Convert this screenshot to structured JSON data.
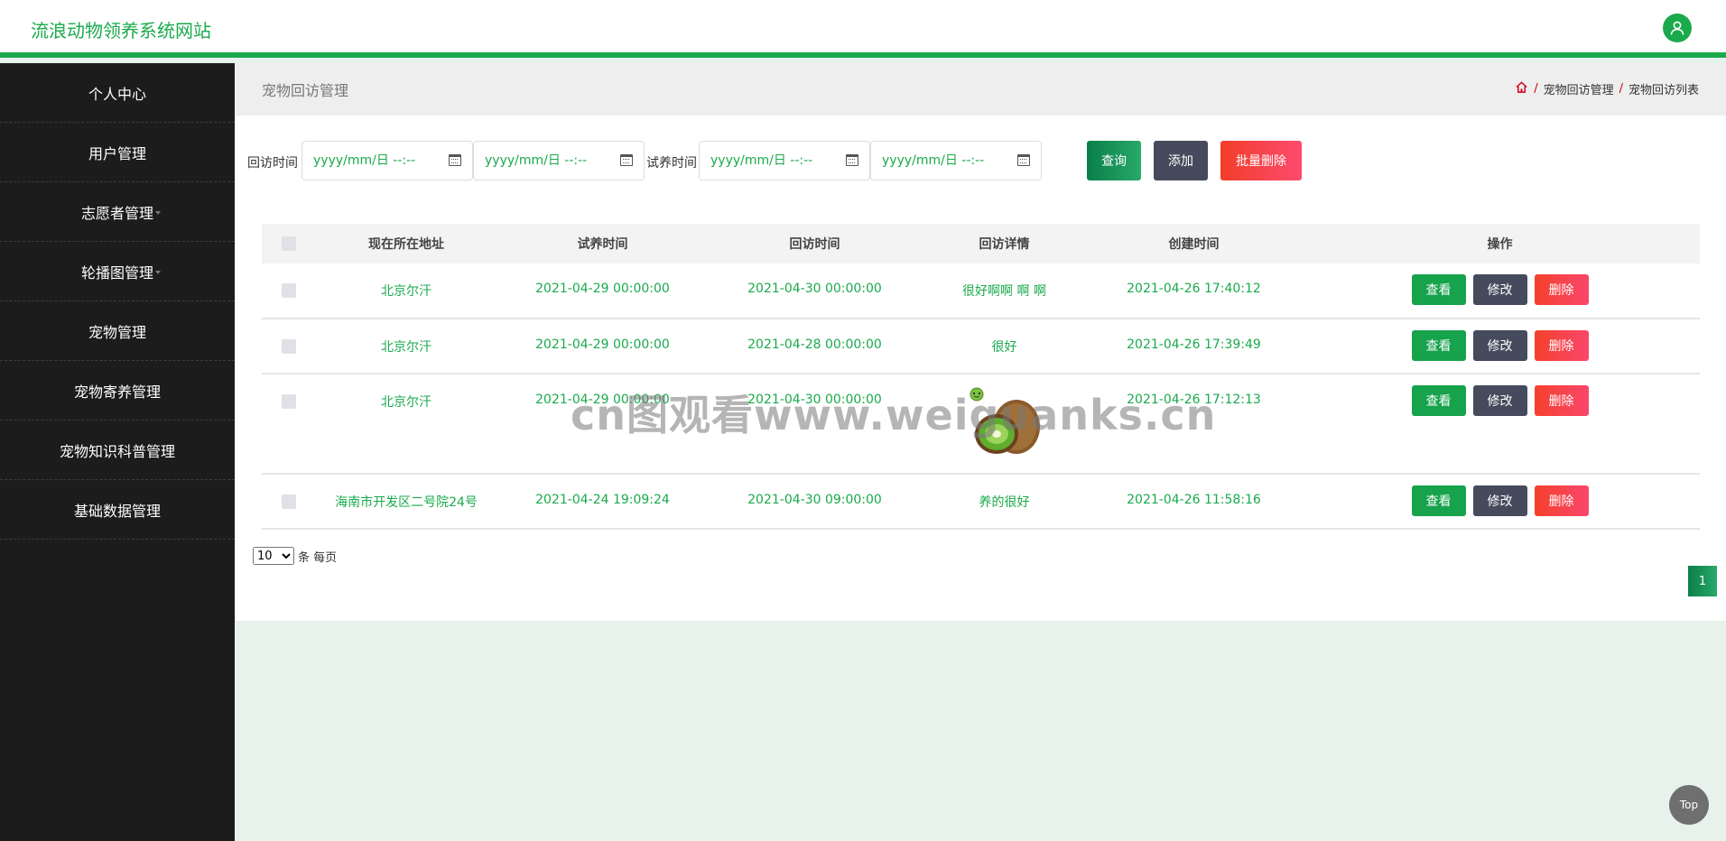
{
  "header": {
    "brand": "流浪动物领养系统网站",
    "user_icon": "user-icon"
  },
  "sidebar": {
    "items": [
      {
        "label": "个人中心",
        "caret": false
      },
      {
        "label": "用户管理",
        "caret": false
      },
      {
        "label": "志愿者管理",
        "caret": true
      },
      {
        "label": "轮播图管理",
        "caret": true
      },
      {
        "label": "宠物管理",
        "caret": false
      },
      {
        "label": "宠物寄养管理",
        "caret": false
      },
      {
        "label": "宠物知识科普管理",
        "caret": false
      },
      {
        "label": "基础数据管理",
        "caret": false
      }
    ]
  },
  "titlebar": {
    "title": "宠物回访管理",
    "breadcrumb": [
      "宠物回访管理",
      "宠物回访列表"
    ]
  },
  "search": {
    "visit_label": "回访时间",
    "trial_label": "试养时间",
    "placeholder": "yyyy/mm/日  --:--",
    "query_label": "查询",
    "add_label": "添加",
    "bulk_delete_label": "批量删除"
  },
  "table": {
    "headers": [
      "现在所在地址",
      "试养时间",
      "回访时间",
      "回访详情",
      "创建时间",
      "操作"
    ],
    "rows": [
      {
        "address": "北京尔汗",
        "trial_time": "2021-04-29 00:00:00",
        "visit_time": "2021-04-30 00:00:00",
        "detail": "很好啊啊 啊 啊",
        "created": "2021-04-26 17:40:12"
      },
      {
        "address": "北京尔汗",
        "trial_time": "2021-04-29 00:00:00",
        "visit_time": "2021-04-28 00:00:00",
        "detail": "很好",
        "created": "2021-04-26 17:39:49"
      },
      {
        "address": "北京尔汗",
        "trial_time": "2021-04-29 00:00:00",
        "visit_time": "2021-04-30 00:00:00",
        "detail": "",
        "created": "2021-04-26 17:12:13"
      },
      {
        "address": "海南市开发区二号院24号",
        "trial_time": "2021-04-24 19:09:24",
        "visit_time": "2021-04-30 09:00:00",
        "detail": "养的很好",
        "created": "2021-04-26 11:58:16"
      }
    ],
    "ops": {
      "view": "查看",
      "edit": "修改",
      "delete": "删除"
    }
  },
  "pager": {
    "page_size": "10",
    "suffix": "条 每页",
    "current_page": "1"
  },
  "watermark": "cn图观看www.weiguanks.cn",
  "top_button": "Top",
  "colors": {
    "accent": "#1aaa4c",
    "sidebar": "#1c1c1c",
    "danger": "#f4412c",
    "dark_button": "#454a5c"
  }
}
